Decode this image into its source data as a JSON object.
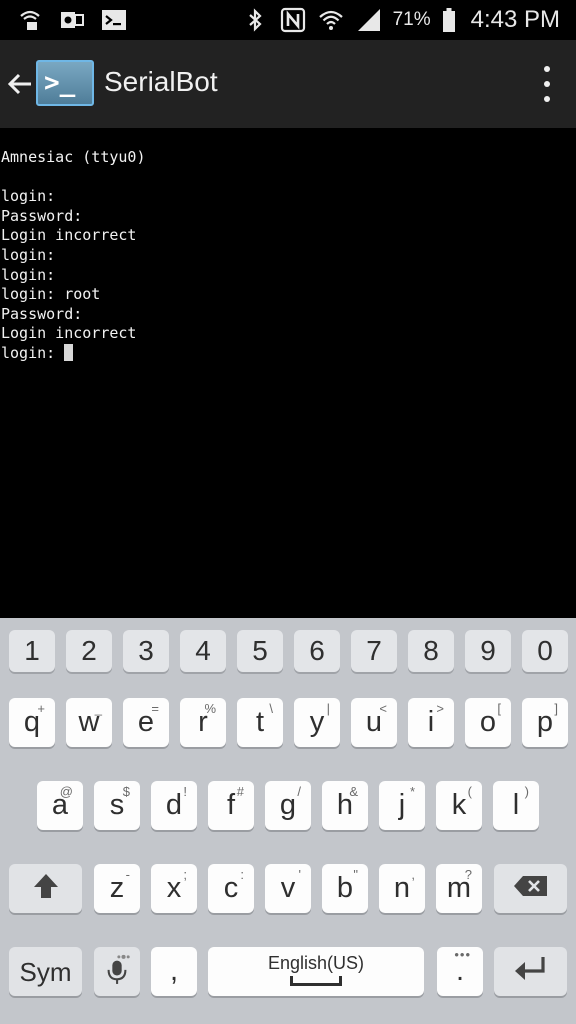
{
  "status_bar": {
    "icons": [
      "wifi-call-icon",
      "outlook-icon",
      "terminal-icon",
      "bluetooth-icon",
      "nfc-icon",
      "wifi-icon",
      "signal-icon",
      "battery-icon"
    ],
    "battery": "71%",
    "time": "4:43 PM"
  },
  "app_bar": {
    "title": "SerialBot",
    "app_icon_glyph": ">_"
  },
  "terminal": {
    "lines": [
      "Amnesiac (ttyu0)",
      "",
      "login:",
      "Password:",
      "Login incorrect",
      "login:",
      "login:",
      "login: root",
      "Password:",
      "Login incorrect",
      "login: "
    ]
  },
  "keyboard": {
    "numbers": [
      "1",
      "2",
      "3",
      "4",
      "5",
      "6",
      "7",
      "8",
      "9",
      "0"
    ],
    "row1": [
      {
        "main": "q",
        "sub": "+"
      },
      {
        "main": "w",
        "sub": "_"
      },
      {
        "main": "e",
        "sub": "="
      },
      {
        "main": "r",
        "sub": "%"
      },
      {
        "main": "t",
        "sub": "\\"
      },
      {
        "main": "y",
        "sub": "|"
      },
      {
        "main": "u",
        "sub": "<"
      },
      {
        "main": "i",
        "sub": ">"
      },
      {
        "main": "o",
        "sub": "["
      },
      {
        "main": "p",
        "sub": "]"
      }
    ],
    "row2": [
      {
        "main": "a",
        "sub": "@"
      },
      {
        "main": "s",
        "sub": "$"
      },
      {
        "main": "d",
        "sub": "!"
      },
      {
        "main": "f",
        "sub": "#"
      },
      {
        "main": "g",
        "sub": "/"
      },
      {
        "main": "h",
        "sub": "&"
      },
      {
        "main": "j",
        "sub": "*"
      },
      {
        "main": "k",
        "sub": "("
      },
      {
        "main": "l",
        "sub": ")"
      }
    ],
    "row3": [
      {
        "main": "z",
        "sub": "-"
      },
      {
        "main": "x",
        "sub": ";"
      },
      {
        "main": "c",
        "sub": ":"
      },
      {
        "main": "v",
        "sub": "'"
      },
      {
        "main": "b",
        "sub": "\""
      },
      {
        "main": "n",
        "sub": ","
      },
      {
        "main": "m",
        "sub": "?"
      }
    ],
    "sym_label": "Sym",
    "comma": ",",
    "space_label": "English(US)",
    "period": "."
  }
}
